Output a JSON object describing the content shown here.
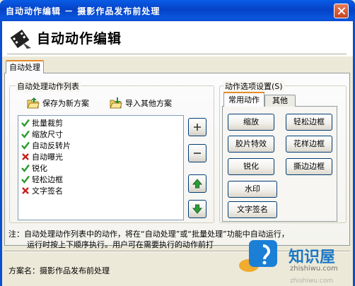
{
  "window": {
    "title": "自动动作编辑 － 摄影作品发布前处理"
  },
  "header": {
    "title": "自动动作编辑"
  },
  "outer_tabs": [
    {
      "label": "自动处理",
      "active": true
    }
  ],
  "list_group": {
    "label": "自动处理动作列表",
    "save_label": "保存为新方案",
    "import_label": "导入其他方案",
    "items": [
      {
        "label": "批量裁剪",
        "status": "check"
      },
      {
        "label": "缩放尺寸",
        "status": "check"
      },
      {
        "label": "自动反转片",
        "status": "check"
      },
      {
        "label": "自动曝光",
        "status": "cross"
      },
      {
        "label": "锐化",
        "status": "check"
      },
      {
        "label": "轻松边框",
        "status": "check"
      },
      {
        "label": "文字签名",
        "status": "cross"
      }
    ]
  },
  "side_buttons": {
    "add": "add-icon",
    "remove": "remove-icon",
    "up": "arrow-up-icon",
    "down": "arrow-down-icon"
  },
  "options_group": {
    "label": "动作选项设置(S)",
    "tabs": [
      {
        "label": "常用动作",
        "active": true
      },
      {
        "label": "其他",
        "active": false
      }
    ],
    "buttons": [
      {
        "label": "缩放"
      },
      {
        "label": "轻松边框"
      },
      {
        "label": "胶片特效"
      },
      {
        "label": "花样边框"
      },
      {
        "label": "锐化"
      },
      {
        "label": "撕边边框"
      },
      {
        "label": "水印"
      },
      {
        "label": "文字签名"
      }
    ]
  },
  "note": {
    "line1": "注：自动处理动作列表中的动作，将在“自动处理”或“批量处理”功能中自动运行，",
    "line2": "运行时按上下顺序执行。用户可在需要执行的动作前打"
  },
  "footer": {
    "scheme_label": "方案名：摄影作品发布前处理"
  },
  "watermark": {
    "text": "知识屋",
    "domain": "zhishiwu.com",
    "domain2": "zhishiwu.com"
  },
  "colors": {
    "titlebar": "#0a5ce6",
    "accent_tab": "#e68b2c",
    "check": "#2a9a2a",
    "cross": "#c81e1e",
    "watermark": "#0b6fc4"
  }
}
